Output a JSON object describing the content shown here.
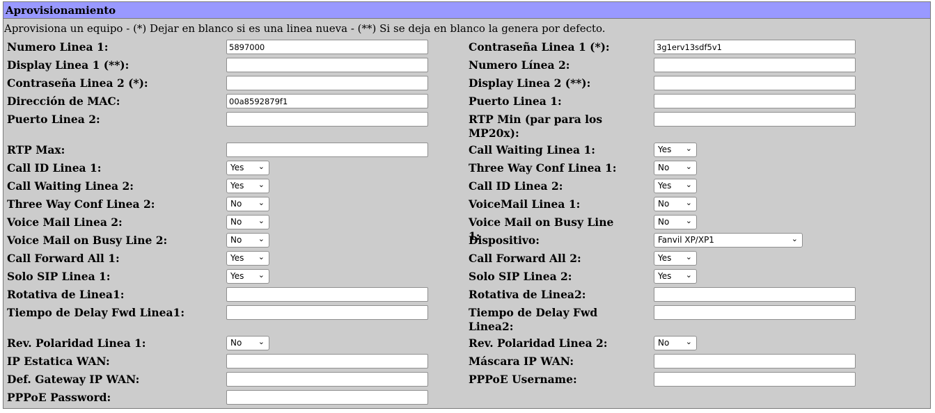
{
  "title": "Aprovisionamiento",
  "description": "Aprovisiona un equipo - (*) Dejar en blanco si es una linea nueva - (**) Si se deja en blanco la genera por defecto.",
  "fields": {
    "numero_linea1": {
      "label": "Numero Linea 1:",
      "value": "5897000"
    },
    "contrasena_linea1": {
      "label": "Contraseña Linea 1 (*):",
      "value": "3g1erv13sdf5v1"
    },
    "display_linea1": {
      "label": "Display Linea 1 (**):",
      "value": ""
    },
    "numero_linea2": {
      "label": "Numero Línea 2:",
      "value": ""
    },
    "contrasena_linea2": {
      "label": "Contraseña Linea 2 (*):",
      "value": ""
    },
    "display_linea2": {
      "label": "Display Linea 2 (**):",
      "value": ""
    },
    "mac": {
      "label": "Dirección de MAC:",
      "value": "00a8592879f1"
    },
    "puerto_linea1": {
      "label": "Puerto Linea 1:",
      "value": ""
    },
    "puerto_linea2": {
      "label": "Puerto Linea 2:",
      "value": ""
    },
    "rtp_min": {
      "label": "RTP Min (par para los MP20x):",
      "value": ""
    },
    "rtp_max": {
      "label": "RTP Max:",
      "value": ""
    },
    "call_waiting1": {
      "label": "Call Waiting Linea 1:",
      "value": "Yes"
    },
    "call_id1": {
      "label": "Call ID Linea 1:",
      "value": "Yes"
    },
    "three_way1": {
      "label": "Three Way Conf Linea 1:",
      "value": "No"
    },
    "call_waiting2": {
      "label": "Call Waiting Linea 2:",
      "value": "Yes"
    },
    "call_id2": {
      "label": "Call ID Linea 2:",
      "value": "Yes"
    },
    "three_way2": {
      "label": "Three Way Conf Linea 2:",
      "value": "No"
    },
    "voicemail1": {
      "label": "VoiceMail Linea 1:",
      "value": "No"
    },
    "voicemail2": {
      "label": "Voice Mail Linea 2:",
      "value": "No"
    },
    "vm_busy1": {
      "label": "Voice Mail on Busy Line 1:",
      "value": "No"
    },
    "vm_busy2": {
      "label": "Voice Mail on Busy Line 2:",
      "value": "No"
    },
    "dispositivo": {
      "label": "Dispositivo:",
      "value": "Fanvil XP/XP1"
    },
    "cfa1": {
      "label": "Call Forward All 1:",
      "value": "Yes"
    },
    "cfa2": {
      "label": "Call Forward All 2:",
      "value": "Yes"
    },
    "solo_sip1": {
      "label": "Solo SIP Linea 1:",
      "value": "Yes"
    },
    "solo_sip2": {
      "label": "Solo SIP Linea 2:",
      "value": "Yes"
    },
    "rotativa1": {
      "label": "Rotativa de Linea1:",
      "value": ""
    },
    "rotativa2": {
      "label": "Rotativa de Linea2:",
      "value": ""
    },
    "delay_fwd1": {
      "label": "Tiempo de Delay Fwd Linea1:",
      "value": ""
    },
    "delay_fwd2": {
      "label": "Tiempo de Delay Fwd Linea2:",
      "value": ""
    },
    "polaridad1": {
      "label": "Rev. Polaridad Linea 1:",
      "value": "No"
    },
    "polaridad2": {
      "label": "Rev. Polaridad Linea 2:",
      "value": "No"
    },
    "ip_wan": {
      "label": "IP Estatica WAN:",
      "value": ""
    },
    "mascara_wan": {
      "label": "Máscara IP WAN:",
      "value": ""
    },
    "gateway_wan": {
      "label": "Def. Gateway IP WAN:",
      "value": ""
    },
    "pppoe_user": {
      "label": "PPPoE Username:",
      "value": ""
    },
    "pppoe_pass": {
      "label": "PPPoE Password:",
      "value": ""
    }
  }
}
